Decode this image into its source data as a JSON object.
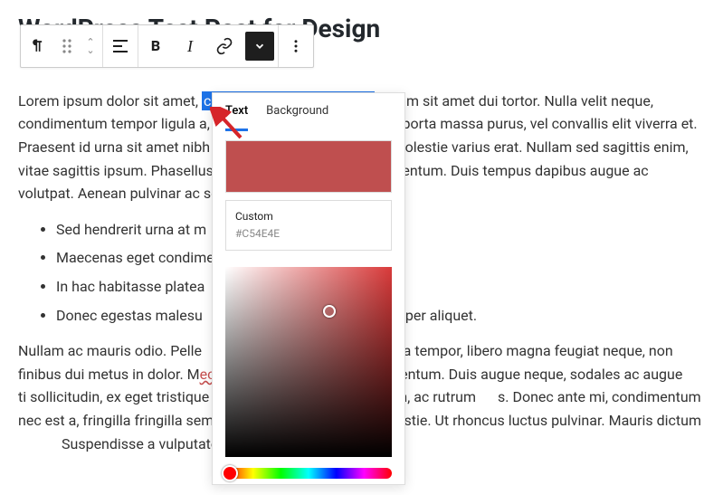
{
  "title": "WordPress Test Post for Design",
  "paragraph1": {
    "before": "Lorem ipsum dolor sit amet, ",
    "highlight": "consectetur adipiscing elit",
    "after": ". Etiam sit amet dui tortor. Nulla velit neque, condimentum tempor ligula a, dictum condimentum nisi. Ut porta massa purus, vel convallis elit viverra et. Praesent id urna sit amet nibh tempor condimentum. Duis molestie varius erat. Nullam sed sagittis enim, vitae sagittis ipsum. Phasellus non venenatis tellus vel elementum. Duis tempus dapibus augue ac volutpat. Aenean pulvinar ac sem pellentesque leo."
  },
  "bullets": [
    "Sed hendrerit urna at m",
    "Maecenas eget condimentum",
    "In hac habitasse platea",
    "Donec egestas malesu"
  ],
  "bullets_tail": "mper aliquet.",
  "paragraph2": {
    "before": "Nullam ac mauris odio. Pelle",
    "mid1": "nia tempor, libero magna feugiat neque, non finibus dui metus in dolor. M",
    "link": "ecenas",
    "mid2": " ornare in tellus vel fermentum. Duis augue neque, sodales ac augue",
    "mid3": "ti sollicitudin, ex eget tristique posuere, leo nisi tempor lorem, ac rutrum",
    "mid4": "s. Donec ante mi, condimentum nec est a, fringilla fringilla sem. Nam",
    "mid5": "dapibus risus ac molestie. Ut rhoncus luctus pulvinar. Mauris dictum",
    "after": "Suspendisse a vulputate libero."
  },
  "toolbar": {
    "icons": {
      "paragraph": "paragraph-icon",
      "drag": "drag-handle-icon",
      "move": "move-updown-icon",
      "align": "align-left-icon",
      "bold": "B",
      "italic": "I",
      "link": "link-icon",
      "more_dropdown": "chevron-down-icon",
      "options": "more-options-icon"
    }
  },
  "popover": {
    "tabs": {
      "text": "Text",
      "background": "Background"
    },
    "custom_label": "Custom",
    "custom_hex": "#C54E4E"
  }
}
